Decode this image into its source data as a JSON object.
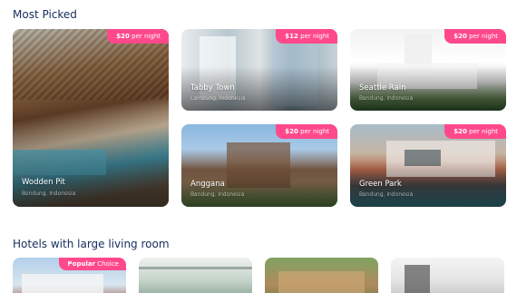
{
  "sections": {
    "most_picked": "Most Picked",
    "large_living": "Hotels with large living room"
  },
  "cards": [
    {
      "price": "$20",
      "unit": "per night",
      "name": "Wodden Pit",
      "location": "Bondung, Indonesia"
    },
    {
      "price": "$12",
      "unit": "per night",
      "name": "Tabby Town",
      "location": "Lampung, Indonesia"
    },
    {
      "price": "$20",
      "unit": "per night",
      "name": "Seattle Rain",
      "location": "Bandung, Indonesia"
    },
    {
      "price": "$20",
      "unit": "per night",
      "name": "Anggana",
      "location": "Bandung, Indonesia"
    },
    {
      "price": "$20",
      "unit": "per night",
      "name": "Green Park",
      "location": "Bandung, Indonesia"
    }
  ],
  "hotels": {
    "badge_bold": "Popular",
    "badge_rest": "Choice"
  },
  "colors": {
    "title": "#152c5b",
    "accent": "#ff498b"
  }
}
